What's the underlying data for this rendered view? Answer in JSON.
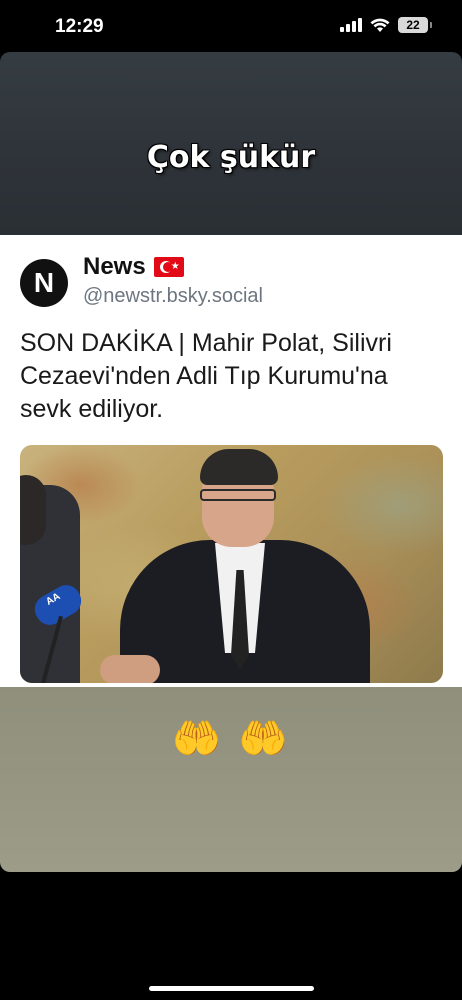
{
  "status_bar": {
    "time": "12:29",
    "battery": "22"
  },
  "story": {
    "caption": "Çok şükür",
    "post": {
      "avatar_letter": "N",
      "name": "News",
      "flag": "TR",
      "handle": "@newstr.bsky.social",
      "text": "SON DAKİKA | Mahir Polat, Silivri Cezaevi'nden Adli Tıp Kurumu'na sevk ediliyor.",
      "photo_mic_label": "AA"
    },
    "emoji": "🤲 🤲"
  },
  "colors": {
    "story_top": "#2e3339",
    "post_background": "#ffffff",
    "story_bottom": "#959582",
    "handle": "#6d7680"
  }
}
